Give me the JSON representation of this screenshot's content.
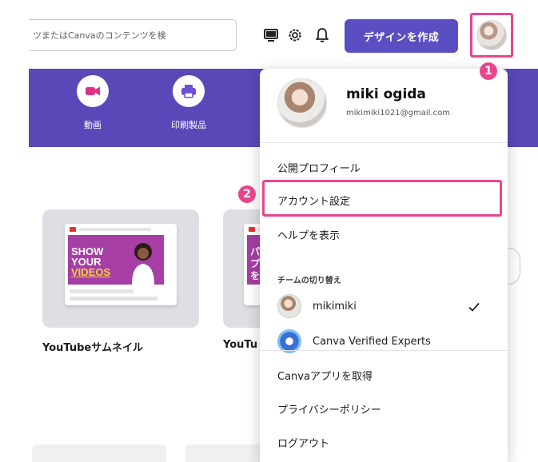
{
  "search": {
    "placeholder": "ツまたはCanvaのコンテンツを検"
  },
  "header": {
    "create_label": "デザインを作成",
    "icons": [
      "monitor-icon",
      "gear-icon",
      "bell-icon"
    ]
  },
  "categories": [
    {
      "label": "動画",
      "icon": "video-camera-icon"
    },
    {
      "label": "印刷製品",
      "icon": "printer-icon"
    }
  ],
  "templates": [
    {
      "caption": "YouTubeサムネイル",
      "thumb_lines": [
        "SHOW",
        "YOUR",
        "VIDEOS"
      ]
    },
    {
      "caption": "YouTu",
      "thumb_lines": [
        "パ",
        "プ",
        "を"
      ]
    }
  ],
  "account": {
    "name": "miki ogida",
    "email": "mikimiki1021@gmail.com"
  },
  "menu": {
    "public_profile": "公開プロフィール",
    "account_settings": "アカウント設定",
    "help": "ヘルプを表示",
    "team_switch_title": "チームの切り替え",
    "teams": [
      {
        "label": "mikimiki",
        "selected": true
      },
      {
        "label": "Canva Verified Experts",
        "selected": false
      }
    ],
    "get_app": "Canvaアプリを取得",
    "privacy": "プライバシーポリシー",
    "logout": "ログアウト"
  },
  "markers": [
    "1",
    "2"
  ],
  "colors": {
    "brand_purple": "#5b4ec2",
    "banner_purple": "#5a48b8",
    "highlight_pink": "#e8458c"
  }
}
